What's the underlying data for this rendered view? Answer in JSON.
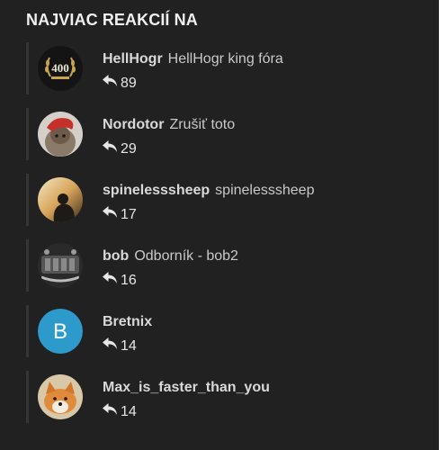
{
  "heading": "NAJVIAC REAKCIÍ NA",
  "users": [
    {
      "name": "HellHogr",
      "title": "HellHogr king fóra",
      "count": "89",
      "avatar": "laurel-400-badge"
    },
    {
      "name": "Nordotor",
      "title": "Zrušiť toto",
      "count": "29",
      "avatar": "red-hooded-figure"
    },
    {
      "name": "spinelesssheep",
      "title": "spinelesssheep",
      "count": "17",
      "avatar": "sunset-silhouette"
    },
    {
      "name": "bob",
      "title": "Odborník - bob2",
      "count": "16",
      "avatar": "engine-photo"
    },
    {
      "name": "Bretnix",
      "title": "",
      "count": "14",
      "avatar": "letter",
      "avatar_letter": "B",
      "avatar_color": "#2c9bcc"
    },
    {
      "name": "Max_is_faster_than_you",
      "title": "",
      "count": "14",
      "avatar": "fox-photo"
    }
  ],
  "colors": {
    "background": "#212121",
    "text": "#d9d9d9",
    "accent_avatar": "#2c9bcc"
  },
  "icon": "reply-icon"
}
